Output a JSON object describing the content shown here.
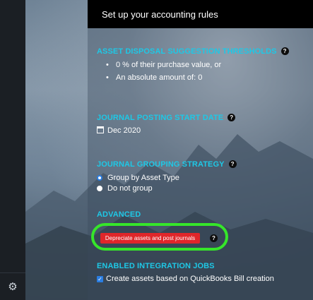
{
  "header": {
    "title": "Set up your accounting rules"
  },
  "sections": {
    "disposal": {
      "title": "ASSET DISPOSAL SUGGESTION THRESHOLDS",
      "bullets": [
        "0 % of their purchase value, or",
        "An absolute amount of: 0"
      ]
    },
    "posting": {
      "title": "JOURNAL POSTING START DATE",
      "date": "Dec 2020"
    },
    "grouping": {
      "title": "JOURNAL GROUPING STRATEGY",
      "options": [
        "Group by Asset Type",
        "Do not group"
      ],
      "selected": "Group by Asset Type"
    },
    "advanced": {
      "title": "ADVANCED",
      "button_label": "Depreciate assets and post journals"
    },
    "integration": {
      "title": "ENABLED INTEGRATION JOBS",
      "checkbox_label": "Create assets based on QuickBooks Bill creation",
      "checked": true
    }
  },
  "icons": {
    "help": "question-circle-icon",
    "calendar": "calendar-icon",
    "settings": "gear-icon"
  },
  "colors": {
    "accent_title": "#1ec8e6",
    "button_red": "#e0262a",
    "highlight_green": "#36e62a",
    "header_bg": "#000000"
  }
}
